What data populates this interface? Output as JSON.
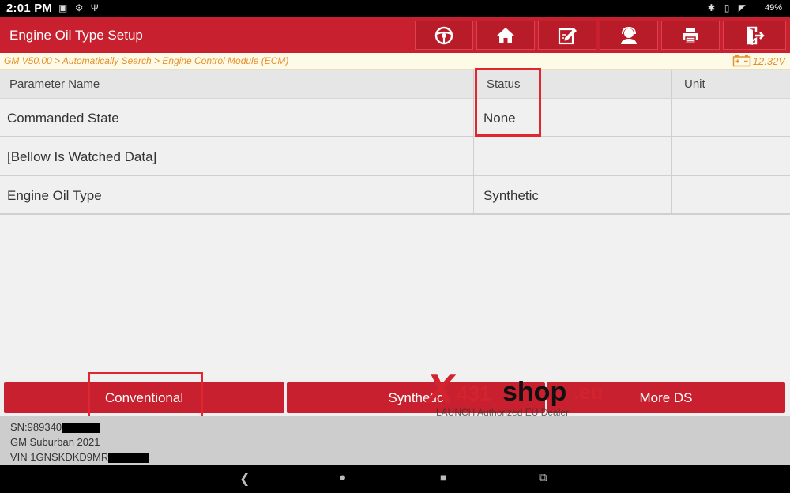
{
  "status_bar": {
    "time": "2:01 PM",
    "left_icons": [
      "image-icon",
      "settings-icon",
      "usb-icon"
    ],
    "right_icons": [
      "bluetooth-icon",
      "vibrate-icon",
      "wifi-icon"
    ],
    "battery": "49%"
  },
  "header": {
    "title": "Engine Oil Type Setup",
    "toolbar": [
      "steering-wheel-icon",
      "home-icon",
      "edit-report-icon",
      "support-icon",
      "print-icon",
      "exit-icon"
    ]
  },
  "breadcrumb": {
    "path": "GM V50.00 > Automatically Search > Engine Control Module (ECM)",
    "voltage": "12.32V"
  },
  "table": {
    "headers": {
      "name": "Parameter Name",
      "status": "Status",
      "unit": "Unit"
    },
    "rows": [
      {
        "name": "Commanded State",
        "status": "None",
        "unit": ""
      },
      {
        "name": "[Bellow Is Watched Data]",
        "status": "",
        "unit": ""
      },
      {
        "name": "Engine Oil Type",
        "status": "Synthetic",
        "unit": ""
      }
    ]
  },
  "buttons": {
    "conventional": "Conventional",
    "synthetic": "Synthetic",
    "more_ds": "More DS"
  },
  "vehicle_info": {
    "sn": "SN:989340",
    "model": "GM Suburban 2021",
    "vin": "VIN 1GNSKDKD9MR"
  },
  "watermark": {
    "x": "X",
    "num": "431",
    "shop": "shop",
    "eu": ".eu",
    "tagline": "LAUNCH Authorized EU Dealer"
  },
  "colors": {
    "brand_red": "#c8202e",
    "breadcrumb_orange": "#e8902a",
    "highlight": "#e0262e"
  }
}
